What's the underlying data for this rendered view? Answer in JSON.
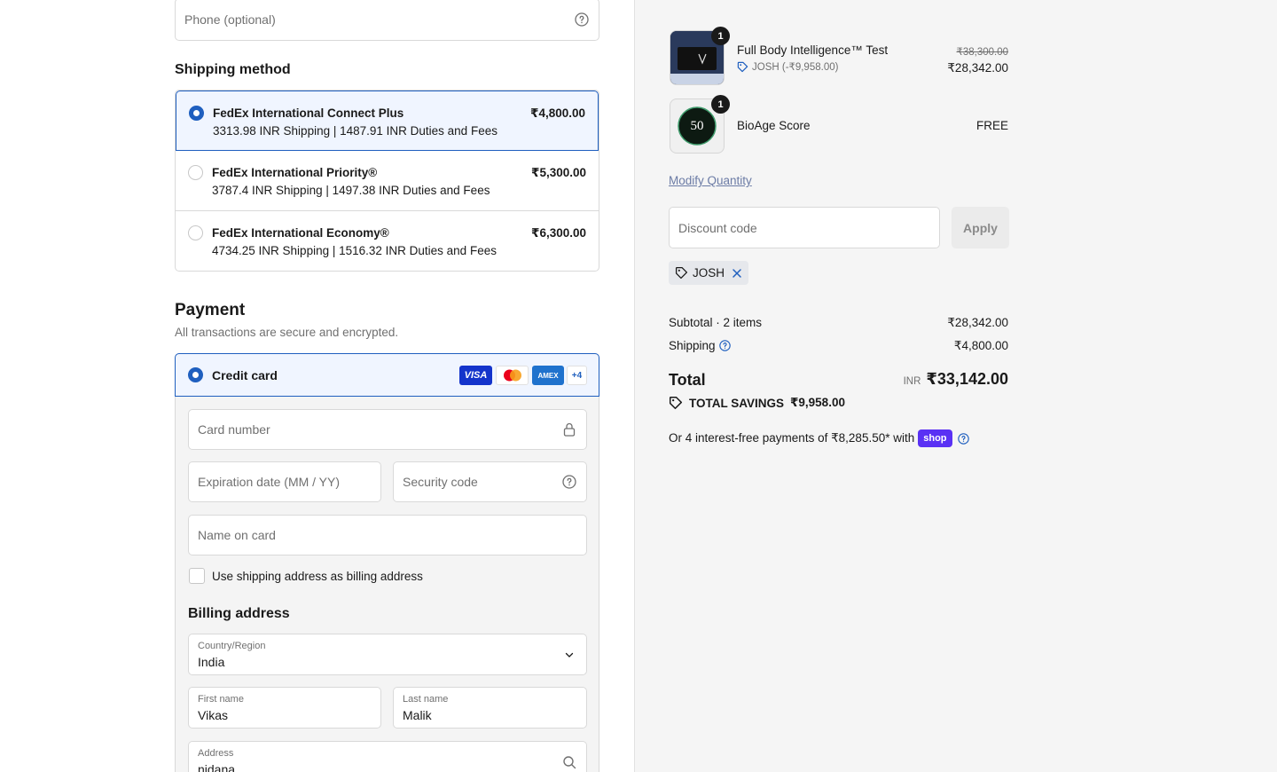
{
  "contact": {
    "phone_placeholder": "Phone (optional)"
  },
  "shipping": {
    "heading": "Shipping method",
    "options": [
      {
        "title": "FedEx International Connect Plus",
        "subtitle": "3313.98 INR Shipping | 1487.91 INR Duties and Fees",
        "price": "₹4,800.00",
        "selected": true
      },
      {
        "title": "FedEx International Priority®",
        "subtitle": "3787.4 INR Shipping | 1497.38 INR Duties and Fees",
        "price": "₹5,300.00",
        "selected": false
      },
      {
        "title": "FedEx International Economy®",
        "subtitle": "4734.25 INR Shipping | 1516.32 INR Duties and Fees",
        "price": "₹6,300.00",
        "selected": false
      }
    ]
  },
  "payment": {
    "heading": "Payment",
    "subheading": "All transactions are secure and encrypted.",
    "method_label": "Credit card",
    "card_brands": [
      "VISA",
      "mastercard",
      "AMEX",
      "+4"
    ],
    "card_number_placeholder": "Card number",
    "expiry_placeholder": "Expiration date (MM / YY)",
    "security_placeholder": "Security code",
    "name_placeholder": "Name on card",
    "use_shipping_label": "Use shipping address as billing address"
  },
  "billing": {
    "heading": "Billing address",
    "country_label": "Country/Region",
    "country_value": "India",
    "first_name_label": "First name",
    "first_name_value": "Vikas",
    "last_name_label": "Last name",
    "last_name_value": "Malik",
    "address_label": "Address",
    "address_value": "nidana"
  },
  "summary": {
    "items": [
      {
        "name": "Full Body Intelligence™ Test",
        "discount": "JOSH (-₹9,958.00)",
        "original_price": "₹38,300.00",
        "price": "₹28,342.00",
        "qty": "1"
      },
      {
        "name": "BioAge Score",
        "price": "FREE",
        "qty": "1",
        "thumb_text": "50"
      }
    ],
    "modify_quantity": "Modify Quantity",
    "discount_placeholder": "Discount code",
    "apply_label": "Apply",
    "applied_code": "JOSH",
    "subtotal_label": "Subtotal · 2 items",
    "subtotal_value": "₹28,342.00",
    "shipping_label": "Shipping",
    "shipping_value": "₹4,800.00",
    "total_label": "Total",
    "total_currency": "INR",
    "total_value": "₹33,142.00",
    "savings_label": "TOTAL SAVINGS",
    "savings_value": "₹9,958.00",
    "installments_text": "Or 4 interest-free payments of ₹8,285.50* with",
    "shop_label": "shop"
  },
  "colors": {
    "accent": "#1f5fbf",
    "shop": "#5a31f4",
    "link": "#6b7ba5"
  }
}
